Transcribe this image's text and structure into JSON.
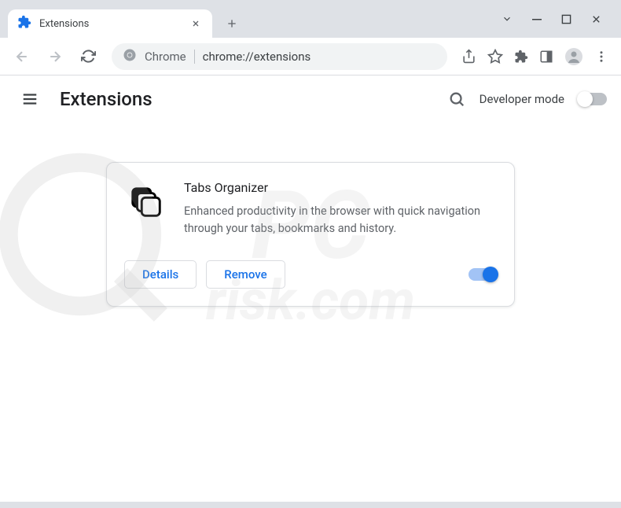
{
  "tab": {
    "title": "Extensions"
  },
  "omnibox": {
    "chrome_label": "Chrome",
    "url_text": "chrome://extensions"
  },
  "page": {
    "title": "Extensions",
    "dev_mode_label": "Developer mode"
  },
  "extension": {
    "name": "Tabs Organizer",
    "description": "Enhanced productivity in the browser with quick navigation through your tabs, bookmarks and history.",
    "details_label": "Details",
    "remove_label": "Remove"
  },
  "watermark": {
    "main": "PC",
    "sub": "risk.com"
  }
}
